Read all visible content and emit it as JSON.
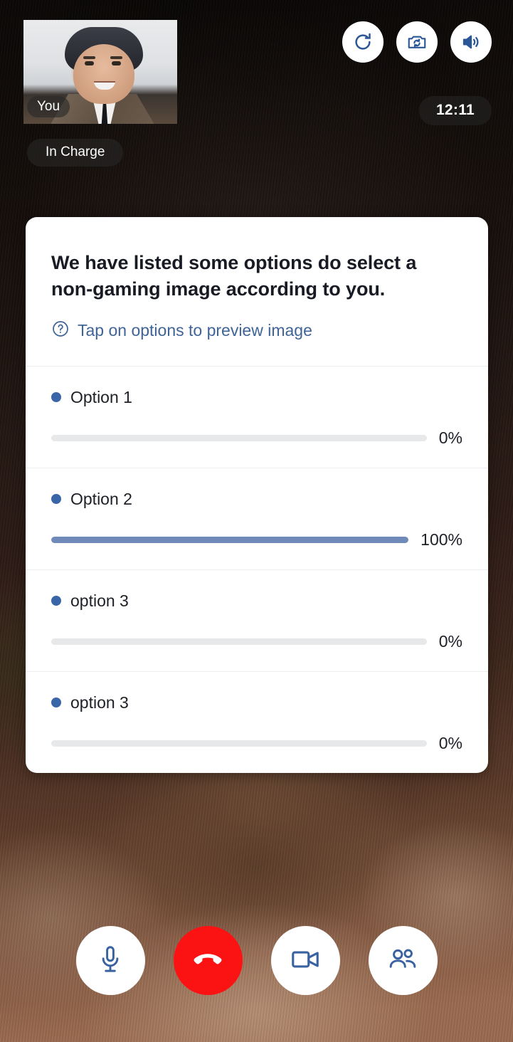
{
  "call": {
    "self_view_label": "You",
    "role_badge": "In Charge",
    "timer": "12:11",
    "top_controls": [
      {
        "name": "refresh-icon",
        "label": "Refresh"
      },
      {
        "name": "switch-camera-icon",
        "label": "Switch camera"
      },
      {
        "name": "speaker-icon",
        "label": "Speaker"
      }
    ],
    "bottom_controls": [
      {
        "name": "microphone-icon",
        "label": "Mute"
      },
      {
        "name": "end-call-icon",
        "label": "End call"
      },
      {
        "name": "video-camera-icon",
        "label": "Camera"
      },
      {
        "name": "participants-icon",
        "label": "Participants"
      }
    ]
  },
  "poll": {
    "title": "We have listed some options do select a non-gaming image according to you.",
    "hint": "Tap on options to preview image",
    "hint_icon": "help-circle-icon",
    "options": [
      {
        "label": "Option 1",
        "percent_text": "0%",
        "percent": 0
      },
      {
        "label": "Option 2",
        "percent_text": "100%",
        "percent": 100
      },
      {
        "label": "option 3",
        "percent_text": "0%",
        "percent": 0
      },
      {
        "label": "option 3",
        "percent_text": "0%",
        "percent": 0
      }
    ]
  },
  "colors": {
    "accent_blue": "#3a66a8",
    "bar_fill": "#6f8ab8",
    "bar_track": "#e6e8ea",
    "link_blue": "#3f6498",
    "end_call_red": "#fb1313"
  }
}
